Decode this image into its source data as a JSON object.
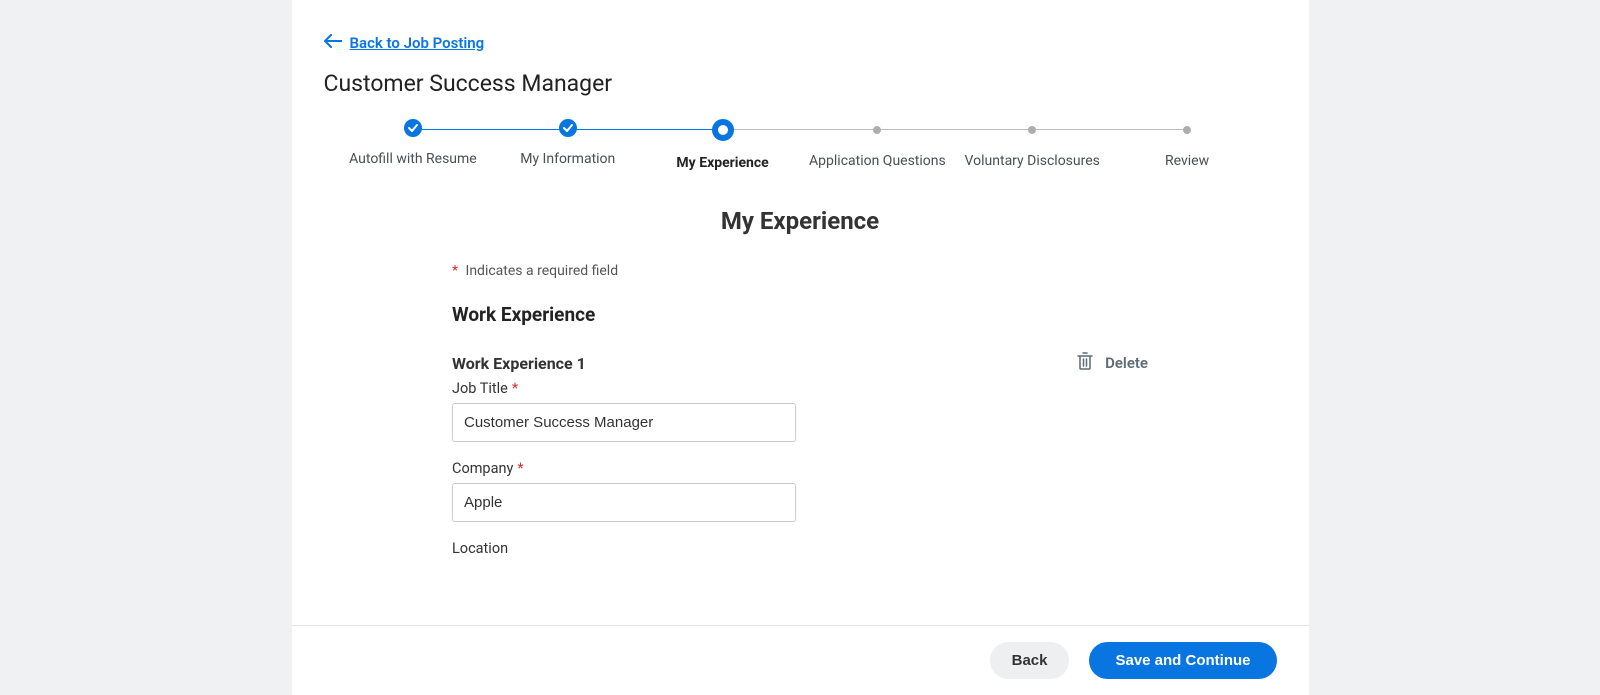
{
  "back_link": "Back to Job Posting",
  "job_title": "Customer Success Manager",
  "steps": {
    "s0": "Autofill with Resume",
    "s1": "My Information",
    "s2": "My Experience",
    "s3": "Application Questions",
    "s4": "Voluntary Disclosures",
    "s5": "Review"
  },
  "heading": "My Experience",
  "required_note": "Indicates a required field",
  "work_experience": {
    "section_label": "Work Experience",
    "entry_label": "Work Experience 1",
    "delete": "Delete",
    "job_title_label": "Job Title",
    "job_title_value": "Customer Success Manager",
    "company_label": "Company",
    "company_value": "Apple",
    "location_label": "Location"
  },
  "footer": {
    "back": "Back",
    "continue": "Save and Continue"
  }
}
